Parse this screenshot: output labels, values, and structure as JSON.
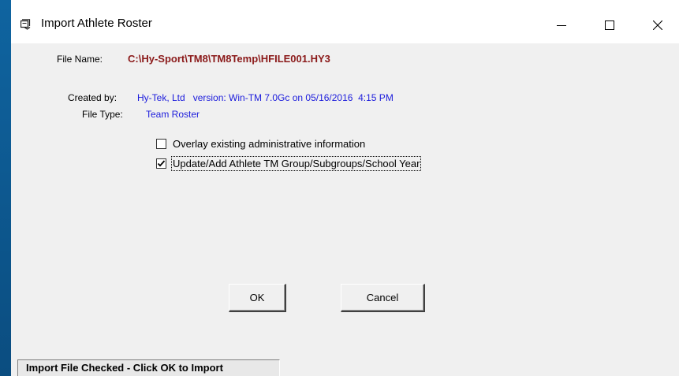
{
  "window": {
    "title": "Import Athlete Roster",
    "icon": "import-roster-icon",
    "controls": [
      "minimize-icon",
      "maximize-icon",
      "close-icon"
    ]
  },
  "file_info": {
    "file_name_label": "File Name:",
    "file_name_value": "C:\\Hy-Sport\\TM8\\TM8Temp\\HFILE001.HY3",
    "created_by_label": "Created by:",
    "created_by_value": "Hy-Tek, Ltd   version: Win-TM 7.0Gc on 05/16/2016  4:15 PM",
    "file_type_label": "File Type:",
    "file_type_value": "Team Roster"
  },
  "options": [
    {
      "label": "Overlay existing administrative information",
      "checked": false
    },
    {
      "label": "Update/Add Athlete TM Group/Subgroups/School Year",
      "checked": true
    }
  ],
  "buttons": {
    "ok_label": "OK",
    "cancel_label": "Cancel"
  },
  "status": {
    "text": "Import File Checked - Click OK to Import"
  },
  "colors": {
    "file_name": "#8b1a1a",
    "info_value": "#1c1cdc",
    "desktop": "#0e5a91"
  }
}
